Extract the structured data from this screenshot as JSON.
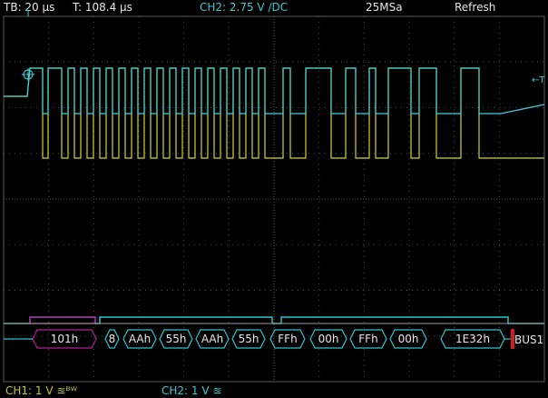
{
  "header": {
    "timebase": "TB: 20 µs",
    "trigger_time": "T: 108.4 µs",
    "channel": "CH2: 2.75 V ∕DC",
    "sample_rate": "25MSa",
    "mode": "Refresh"
  },
  "footer": {
    "ch1": "CH1: 1 V ≊ᴮᵂ",
    "ch2": "CH2: 1 V ≊"
  },
  "bus": {
    "label": "BUS1",
    "values": [
      "101h",
      "8",
      "AAh",
      "55h",
      "AAh",
      "55h",
      "FFh",
      "00h",
      "FFh",
      "00h",
      "1E32h"
    ]
  },
  "colors": {
    "ch1": "#d6d22c",
    "ch2": "#3fd1d9",
    "bus_address": "#b0209a",
    "bus_data": "#2fc4cc",
    "bus_idle": "#9a9a9a",
    "marker": "#d21e1e",
    "grid": "#4a4a4a"
  },
  "markers": {
    "trigger_level": "T",
    "trigger_level_right": "←T"
  }
}
